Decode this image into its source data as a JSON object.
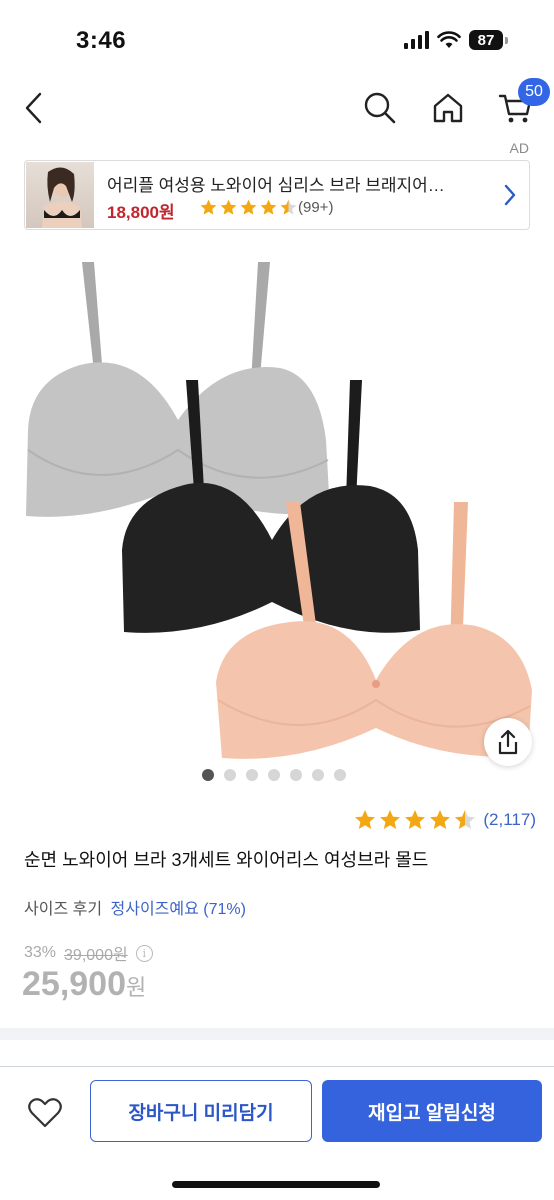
{
  "status_bar": {
    "time": "3:46",
    "battery": "87"
  },
  "nav": {
    "back_icon": "chevron-left-icon",
    "search_icon": "search-icon",
    "home_icon": "home-icon",
    "cart_icon": "cart-icon",
    "cart_count": "50"
  },
  "ad": {
    "label": "AD",
    "title": "어리플 여성용 노와이어 심리스 브라 브래지어…",
    "price": "18,800원",
    "rating": 4.5,
    "review_count": "(99+)"
  },
  "gallery": {
    "image_count": 7,
    "active_index": 0,
    "share_icon": "share-icon"
  },
  "product": {
    "rating": 4.5,
    "review_count": "(2,117)",
    "title": "순면 노와이어 브라 3개세트 와이어리스 여성브라 몰드",
    "size_review_label": "사이즈 후기",
    "size_review_value": "정사이즈예요 (71%)",
    "discount": "33%",
    "original_price": "39,000원",
    "price_number": "25,900",
    "price_unit": "원"
  },
  "bottom_bar": {
    "wish_icon": "heart-icon",
    "cart_button": "장바구니 미리담기",
    "restock_button": "재입고 알림신청"
  },
  "colors": {
    "accent": "#3563de",
    "link": "#3b63c8",
    "ad_price": "#c0262d",
    "star": "#f3a712"
  }
}
